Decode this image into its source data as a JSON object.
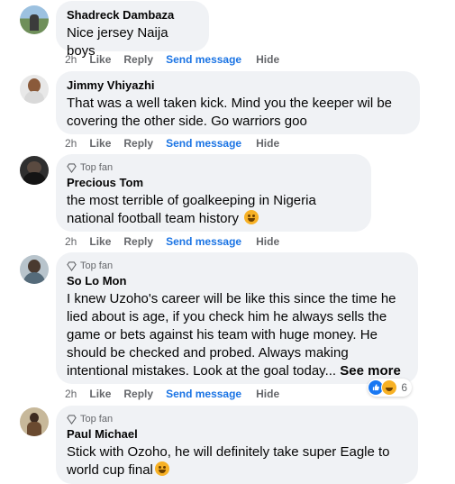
{
  "comments": [
    {
      "name": "Shadreck Dambaza",
      "text": "Nice jersey Naija boys",
      "time": "2h",
      "top_fan": false
    },
    {
      "name": "Jimmy Vhiyazhi",
      "text": "That was a well taken kick. Mind you the keeper wil be covering the other side. Go warriors goo",
      "time": "2h",
      "top_fan": false
    },
    {
      "name": "Precious Tom",
      "badge": "Top fan",
      "text": "the most terrible of goalkeeping in Nigeria national football team history",
      "time": "2h",
      "top_fan": true
    },
    {
      "name": "So Lo Mon",
      "badge": "Top fan",
      "text": "I knew Uzoho's career will be like this since the time he lied about is age, if you check him he always sells the game or bets against his team with huge money. He should be checked and probed. Always making intentional mistakes. Look at the goal today...",
      "see_more": "See more",
      "time": "2h",
      "reaction_count": "6",
      "top_fan": true
    },
    {
      "name": "Paul Michael",
      "badge": "Top fan",
      "text": "Stick with Ozoho, he will definitely take super Eagle to world cup final",
      "top_fan": true
    }
  ],
  "actions": {
    "like": "Like",
    "reply": "Reply",
    "send_message": "Send message",
    "hide": "Hide"
  },
  "colors": {
    "bubble": "#f0f2f5",
    "link_blue": "#1b74e4",
    "meta_gray": "#65676b",
    "text": "#050505"
  }
}
